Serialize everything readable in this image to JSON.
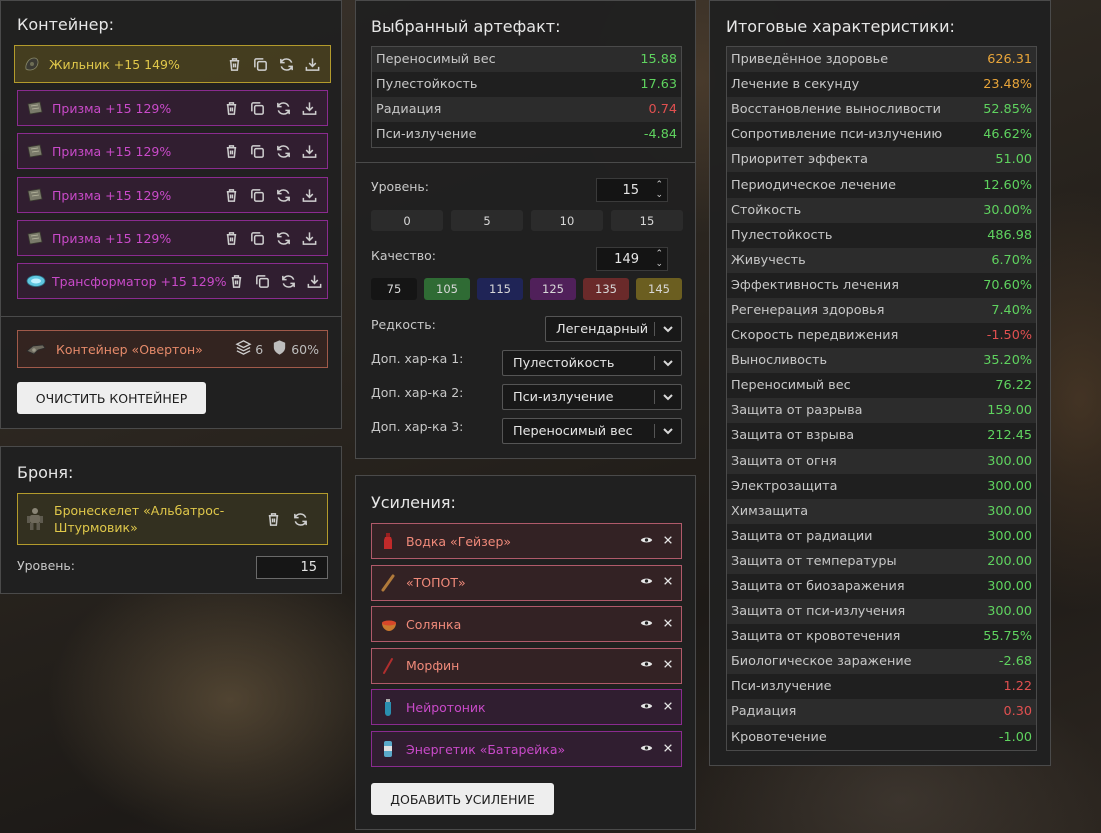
{
  "container": {
    "title": "Контейнер:",
    "slots": [
      {
        "label": "Жильник +15 149%",
        "rarity": "legendary",
        "icon": "zhilnik-icon"
      },
      {
        "label": "Призма +15 129%",
        "rarity": "epic",
        "icon": "prism-icon"
      },
      {
        "label": "Призма +15 129%",
        "rarity": "epic",
        "icon": "prism-icon"
      },
      {
        "label": "Призма +15 129%",
        "rarity": "epic",
        "icon": "prism-icon"
      },
      {
        "label": "Призма +15 129%",
        "rarity": "epic",
        "icon": "prism-icon"
      },
      {
        "label": "Трансформатор +15 129%",
        "rarity": "epic",
        "icon": "transformer-icon"
      }
    ],
    "item": {
      "label": "Контейнер «Овертон»",
      "slots_count": "6",
      "protection": "60%"
    },
    "clear_button": "ОЧИСТИТЬ КОНТЕЙНЕР"
  },
  "armor": {
    "title": "Броня:",
    "item_label": "Бронескелет «Альбатрос-Штурмовик»",
    "level_label": "Уровень:",
    "level_value": "15"
  },
  "artifact": {
    "title": "Выбранный артефакт:",
    "stats": [
      {
        "name": "Переносимый вес",
        "value": "15.88",
        "tone": "green"
      },
      {
        "name": "Пулестойкость",
        "value": "17.63",
        "tone": "green"
      },
      {
        "name": "Радиация",
        "value": "0.74",
        "tone": "red"
      },
      {
        "name": "Пси-излучение",
        "value": "-4.84",
        "tone": "green"
      }
    ],
    "level_label": "Уровень:",
    "level_value": "15",
    "level_presets": [
      "0",
      "5",
      "10",
      "15"
    ],
    "quality_label": "Качество:",
    "quality_value": "149",
    "quality_presets": [
      {
        "label": "75",
        "color": "#151515"
      },
      {
        "label": "105",
        "color": "#2f6b34"
      },
      {
        "label": "115",
        "color": "#1f2456"
      },
      {
        "label": "125",
        "color": "#50205a"
      },
      {
        "label": "135",
        "color": "#6a2a2a"
      },
      {
        "label": "145",
        "color": "#6b5e20"
      }
    ],
    "rarity_label": "Редкость:",
    "rarity_value": "Легендарный",
    "extra1_label": "Доп. хар-ка 1:",
    "extra1_value": "Пулестойкость",
    "extra2_label": "Доп. хар-ка 2:",
    "extra2_value": "Пси-излучение",
    "extra3_label": "Доп. хар-ка 3:",
    "extra3_value": "Переносимый вес"
  },
  "boosts": {
    "title": "Усиления:",
    "items": [
      {
        "label": "Водка «Гейзер»",
        "tone": "red",
        "icon": "vodka-bottle-icon"
      },
      {
        "label": "«ТОПОТ»",
        "tone": "red",
        "icon": "stick-icon"
      },
      {
        "label": "Солянка",
        "tone": "red",
        "icon": "soup-bowl-icon"
      },
      {
        "label": "Морфин",
        "tone": "red",
        "icon": "syringe-icon"
      },
      {
        "label": "Нейротоник",
        "tone": "purple",
        "icon": "vial-icon"
      },
      {
        "label": "Энергетик «Батарейка»",
        "tone": "purple",
        "icon": "energy-drink-icon"
      }
    ],
    "add_button": "ДОБАВИТЬ УСИЛЕНИЕ"
  },
  "totals": {
    "title": "Итоговые характеристики:",
    "stats": [
      {
        "name": "Приведённое здоровье",
        "value": "626.31",
        "tone": "orange"
      },
      {
        "name": "Лечение в секунду",
        "value": "23.48%",
        "tone": "orange"
      },
      {
        "name": "Восстановление выносливости",
        "value": "52.85%",
        "tone": "green"
      },
      {
        "name": "Сопротивление пси-излучению",
        "value": "46.62%",
        "tone": "green"
      },
      {
        "name": "Приоритет эффекта",
        "value": "51.00",
        "tone": "green"
      },
      {
        "name": "Периодическое лечение",
        "value": "12.60%",
        "tone": "green"
      },
      {
        "name": "Стойкость",
        "value": "30.00%",
        "tone": "green"
      },
      {
        "name": "Пулестойкость",
        "value": "486.98",
        "tone": "green"
      },
      {
        "name": "Живучесть",
        "value": "6.70%",
        "tone": "green"
      },
      {
        "name": "Эффективность лечения",
        "value": "70.60%",
        "tone": "green"
      },
      {
        "name": "Регенерация здоровья",
        "value": "7.40%",
        "tone": "green"
      },
      {
        "name": "Скорость передвижения",
        "value": "-1.50%",
        "tone": "red"
      },
      {
        "name": "Выносливость",
        "value": "35.20%",
        "tone": "green"
      },
      {
        "name": "Переносимый вес",
        "value": "76.22",
        "tone": "green"
      },
      {
        "name": "Защита от разрыва",
        "value": "159.00",
        "tone": "green"
      },
      {
        "name": "Защита от взрыва",
        "value": "212.45",
        "tone": "green"
      },
      {
        "name": "Защита от огня",
        "value": "300.00",
        "tone": "green"
      },
      {
        "name": "Электрозащита",
        "value": "300.00",
        "tone": "green"
      },
      {
        "name": "Химзащита",
        "value": "300.00",
        "tone": "green"
      },
      {
        "name": "Защита от радиации",
        "value": "300.00",
        "tone": "green"
      },
      {
        "name": "Защита от температуры",
        "value": "200.00",
        "tone": "green"
      },
      {
        "name": "Защита от биозаражения",
        "value": "300.00",
        "tone": "green"
      },
      {
        "name": "Защита от пси-излучения",
        "value": "300.00",
        "tone": "green"
      },
      {
        "name": "Защита от кровотечения",
        "value": "55.75%",
        "tone": "green"
      },
      {
        "name": "Биологическое заражение",
        "value": "-2.68",
        "tone": "green"
      },
      {
        "name": "Пси-излучение",
        "value": "1.22",
        "tone": "red"
      },
      {
        "name": "Радиация",
        "value": "0.30",
        "tone": "red"
      },
      {
        "name": "Кровотечение",
        "value": "-1.00",
        "tone": "green"
      }
    ]
  }
}
